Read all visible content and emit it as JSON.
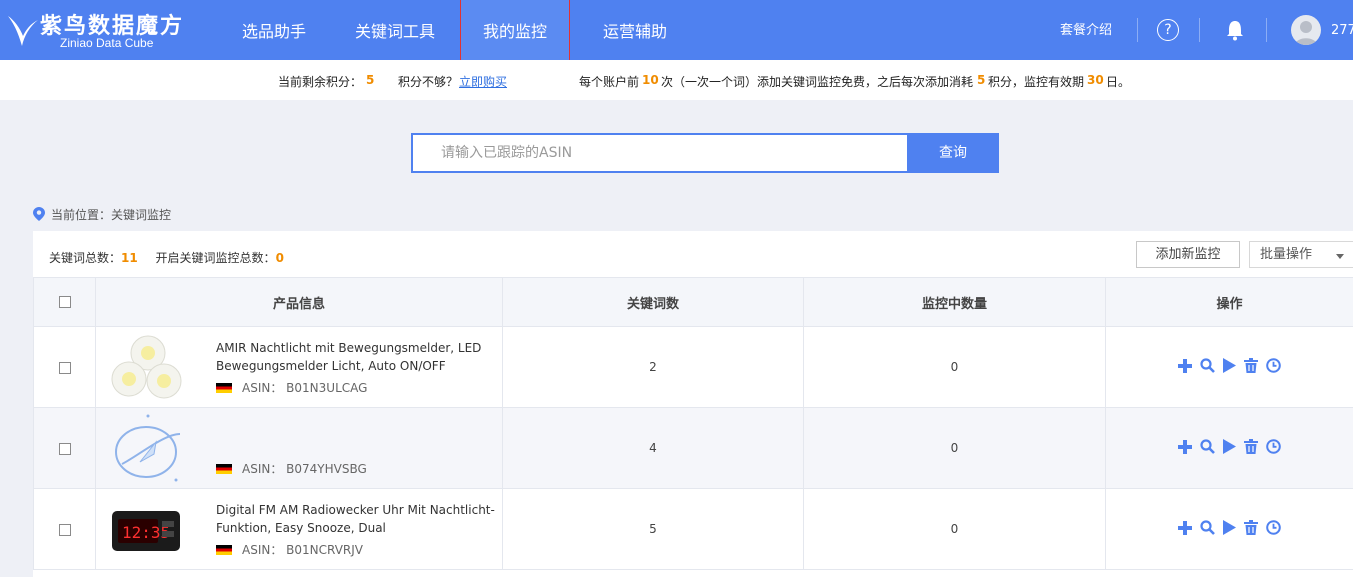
{
  "logo": {
    "title": "紫鸟数据魔方",
    "subtitle": "Ziniao Data Cube"
  },
  "nav": {
    "items": [
      {
        "label": "选品助手"
      },
      {
        "label": "关键词工具"
      },
      {
        "label": "我的监控",
        "active": true
      },
      {
        "label": "运营辅助"
      }
    ],
    "package_label": "套餐介绍",
    "help_label": "?",
    "user_label": "277"
  },
  "infobar": {
    "points_label": "当前剩余积分：",
    "points_value": "5",
    "not_enough": "积分不够？",
    "buy_link": "立即购买",
    "rule_1": "每个账户前",
    "rule_free_count": "10",
    "rule_2": "次（一次一个词）添加关键词监控免费，之后每次添加消耗",
    "rule_cost": "5",
    "rule_3": "积分，监控有效期",
    "rule_days": "30",
    "rule_4": "日。"
  },
  "search": {
    "placeholder": "请输入已跟踪的ASIN",
    "button": "查询"
  },
  "breadcrumb": "当前位置：关键词监控",
  "stats": {
    "keyword_total_label": "关键词总数：",
    "keyword_total": "11",
    "enabled_label": "开启关键词监控总数：",
    "enabled_total": "0"
  },
  "toolbar": {
    "add_label": "添加新监控",
    "batch_label": "批量操作"
  },
  "table": {
    "headers": [
      "产品信息",
      "关键词数",
      "监控中数量",
      "操作"
    ],
    "rows": [
      {
        "title": "AMIR Nachtlicht mit Bewegungsmelder, LED Bewegungsmelder Licht, Auto ON/OFF",
        "asin_label": "ASIN：",
        "asin": "B01N3ULCAG",
        "keywords": "2",
        "monitoring": "0",
        "image": "led-lights"
      },
      {
        "title": "",
        "asin_label": "ASIN：",
        "asin": "B074YHVSBG",
        "keywords": "4",
        "monitoring": "0",
        "image": "placeholder-rocket"
      },
      {
        "title": "Digital FM AM Radiowecker Uhr Mit Nachtlicht-Funktion, Easy Snooze, Dual",
        "asin_label": "ASIN：",
        "asin": "B01NCRVRJV",
        "keywords": "5",
        "monitoring": "0",
        "image": "alarm-clock"
      }
    ],
    "operations": [
      "plus-icon",
      "search-icon",
      "play-icon",
      "trash-icon",
      "clock-icon"
    ]
  },
  "colors": {
    "primary": "#4f81f0",
    "accent": "#f08c00"
  }
}
